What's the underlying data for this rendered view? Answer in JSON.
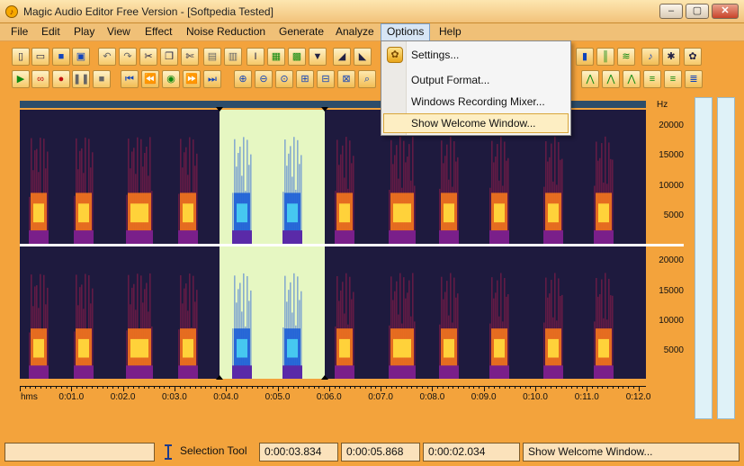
{
  "window": {
    "title": "Magic Audio Editor Free Version - [Softpedia Tested]"
  },
  "menu": [
    {
      "label": "File"
    },
    {
      "label": "Edit"
    },
    {
      "label": "Play"
    },
    {
      "label": "View"
    },
    {
      "label": "Effect"
    },
    {
      "label": "Noise Reduction"
    },
    {
      "label": "Generate"
    },
    {
      "label": "Analyze"
    },
    {
      "label": "Options"
    },
    {
      "label": "Help"
    }
  ],
  "options_menu": {
    "items": [
      {
        "label": "Settings..."
      },
      {
        "label": "Output Format..."
      },
      {
        "label": "Windows Recording Mixer..."
      },
      {
        "label": "Show Welcome Window..."
      }
    ],
    "highlighted_index": 3
  },
  "spectrogram": {
    "hz_unit": "Hz",
    "hz_labels": [
      "20000",
      "15000",
      "10000",
      "5000"
    ],
    "selection_start": "0:00:03.834",
    "selection_end": "0:00:05.868"
  },
  "ruler": {
    "labels": [
      "hms",
      "0:01.0",
      "0:02.0",
      "0:03.0",
      "0:04.0",
      "0:05.0",
      "0:06.0",
      "0:07.0",
      "0:08.0",
      "0:09.0",
      "0:10.0",
      "0:11.0",
      "0:12.0"
    ]
  },
  "status": {
    "tool": "Selection Tool",
    "start": "0:00:03.834",
    "end": "0:00:05.868",
    "length": "0:00:02.034",
    "message": "Show Welcome Window..."
  },
  "colors": {
    "frame": "#f3a33c",
    "selection": "#e6f7c2",
    "spectrogram_bg": "#1e1a3e"
  }
}
